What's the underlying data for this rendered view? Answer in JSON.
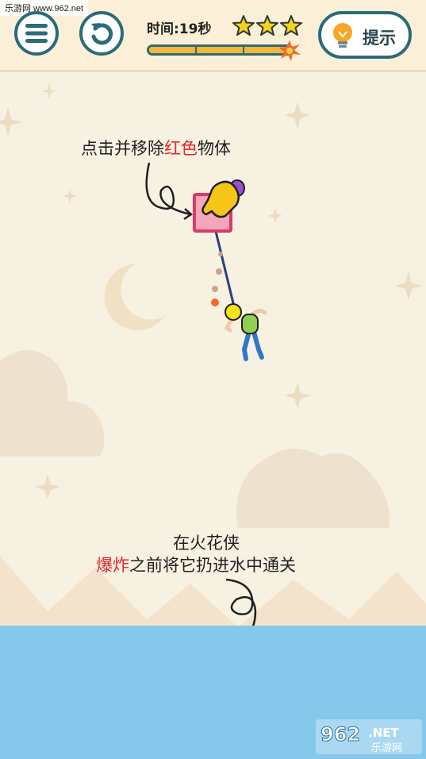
{
  "watermark_top": "乐游网 www.962.net",
  "header": {
    "timer_text": "时间:19秒",
    "stars_count": 3,
    "progress_fraction": 0.97,
    "hint_label": "提示"
  },
  "instructions": {
    "line1_prefix": "点击并移除",
    "line1_highlight": "红色",
    "line1_suffix": "物体",
    "line2": "在火花侠",
    "line3_highlight": "爆炸",
    "line3_suffix": "之前将它扔进水中通关"
  },
  "watermark_bottom": {
    "brand": "962",
    "tld": ".NET",
    "site_name": "乐游网"
  },
  "colors": {
    "accent": "#2b6b7a",
    "background": "#f7f1e2",
    "block": "#f4a7b9",
    "block_border": "#d93a6b",
    "water": "#86c8ec",
    "highlight_text": "#e4262b",
    "star": "#f5d31c"
  },
  "icons": [
    "menu-icon",
    "restart-icon",
    "star-icon",
    "fuse-spark-icon",
    "lightbulb-icon",
    "pointing-hand-icon",
    "crescent-moon-icon"
  ]
}
